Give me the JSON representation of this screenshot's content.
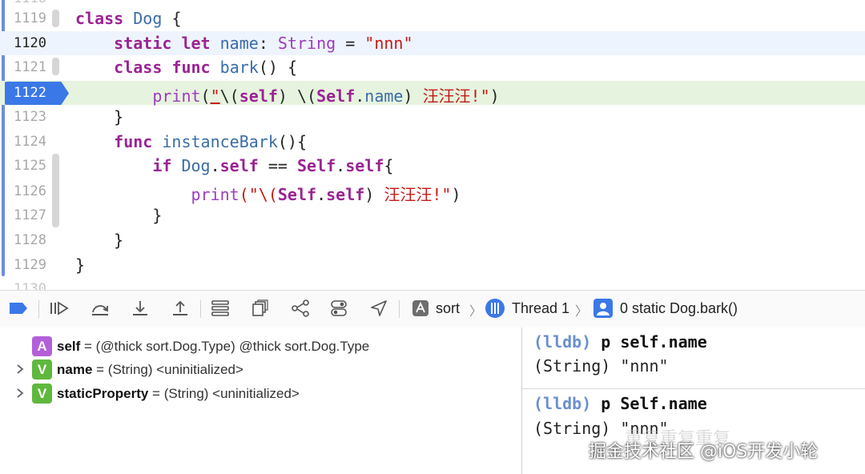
{
  "editor": {
    "clipped_top_number": "1118",
    "clipped_bottom_number": "1130",
    "lines": [
      {
        "number": "1119"
      },
      {
        "number": "1120"
      },
      {
        "number": "1121"
      },
      {
        "number": "1122"
      },
      {
        "number": "1123"
      },
      {
        "number": "1124"
      },
      {
        "number": "1125"
      },
      {
        "number": "1126"
      },
      {
        "number": "1127"
      },
      {
        "number": "1128"
      },
      {
        "number": "1129"
      }
    ],
    "tokens": {
      "l1119": [
        "class",
        "Dog",
        "{"
      ],
      "l1120": [
        "static",
        "let",
        "name",
        ":",
        "String",
        "=",
        "\"nnn\""
      ],
      "l1121": [
        "class",
        "func",
        "bark",
        "() {"
      ],
      "l1122": [
        "print",
        "(",
        "\"",
        "\\(",
        "self",
        ") \\(",
        "Self",
        ".",
        "name",
        ") ",
        "汪汪汪!\"",
        ")"
      ],
      "l1123": [
        "}"
      ],
      "l1124": [
        "func",
        "instanceBark",
        "(){"
      ],
      "l1125": [
        "if",
        "Dog",
        ".",
        "self",
        "==",
        "Self",
        ".",
        "self",
        "{"
      ],
      "l1126": [
        "print",
        "(\"\\(",
        "Self",
        ".",
        "self",
        ") ",
        "汪汪汪!\"",
        ")"
      ],
      "l1127": [
        "}"
      ],
      "l1128": [
        "}"
      ],
      "l1129": [
        "}"
      ]
    }
  },
  "toolbar": {
    "icons": [
      "breakpoints-toggle-icon",
      "continue-icon",
      "step-over-icon",
      "step-into-icon",
      "step-out-icon",
      "view-hierarchy-icon",
      "memory-graph-icon",
      "environment-icon",
      "simulate-location-icon",
      "location-arrow-icon"
    ],
    "breadcrumb": {
      "target": "sort",
      "thread": "Thread 1",
      "frame": "0 static Dog.bark()"
    },
    "accent_color": "#3b78e7"
  },
  "variables": [
    {
      "badge": "A",
      "badge_color": "#b45fd8",
      "name": "self",
      "value": " = (@thick sort.Dog.Type) @thick sort.Dog.Type",
      "expandable": false
    },
    {
      "badge": "V",
      "badge_color": "#5fb83d",
      "name": "name",
      "value": " = (String) <uninitialized>",
      "expandable": true
    },
    {
      "badge": "V",
      "badge_color": "#5fb83d",
      "name": "staticProperty",
      "value": " = (String) <uninitialized>",
      "expandable": true
    }
  ],
  "console": {
    "entries": [
      {
        "prompt": "(lldb)",
        "command": "p self.name",
        "output": "(String) \"nnn\""
      },
      {
        "prompt": "(lldb)",
        "command": "p Self.name",
        "output": "(String) \"nnn\""
      }
    ]
  },
  "watermark": {
    "line1": "重复重复重复",
    "line2": "掘金技术社区 @iOS开发小轮"
  }
}
